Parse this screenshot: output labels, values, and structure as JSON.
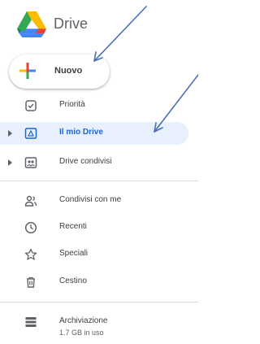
{
  "header": {
    "title": "Drive"
  },
  "new_button": {
    "label": "Nuovo"
  },
  "nav": {
    "items": [
      {
        "label": "Priorità"
      },
      {
        "label": "Il mio Drive"
      },
      {
        "label": "Drive condivisi"
      },
      {
        "label": "Condivisi con me"
      },
      {
        "label": "Recenti"
      },
      {
        "label": "Speciali"
      },
      {
        "label": "Cestino"
      }
    ]
  },
  "storage": {
    "label": "Archiviazione",
    "usage": "1.7 GB in uso"
  },
  "colors": {
    "accent": "#1967d2",
    "active_bg": "#e8f0fe",
    "annotation_arrow": "#4a6fb5"
  },
  "icons": [
    "drive-logo",
    "plus-icon",
    "check-square-icon",
    "my-drive-icon",
    "shared-drives-icon",
    "people-icon",
    "clock-icon",
    "star-icon",
    "trash-icon",
    "storage-icon"
  ]
}
